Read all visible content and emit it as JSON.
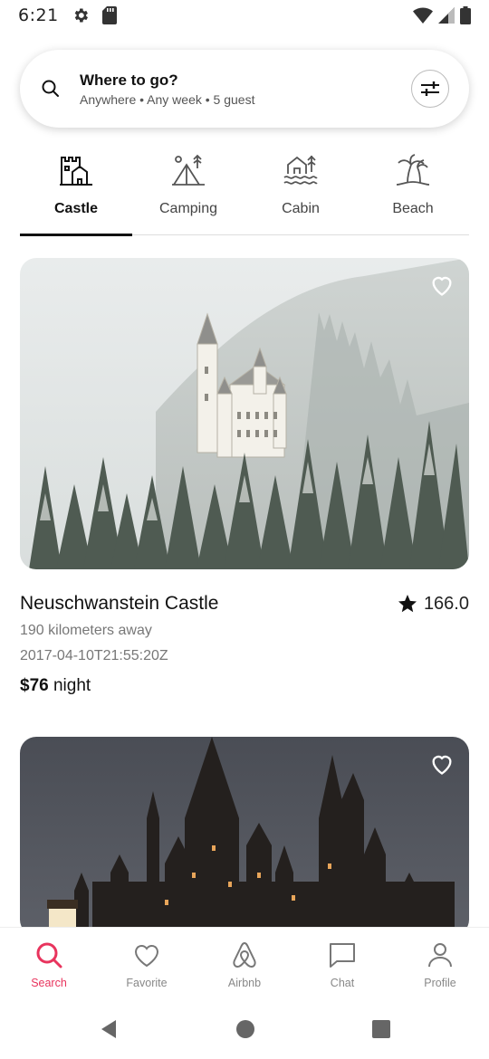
{
  "status_bar": {
    "time": "6:21",
    "icons": [
      "gear-icon",
      "sd-card-icon",
      "wifi-icon",
      "signal-icon",
      "battery-icon"
    ]
  },
  "search": {
    "title": "Where to go?",
    "subtitle": "Anywhere • Any week • 5 guest",
    "icon": "search-icon",
    "filter_icon": "sliders-icon"
  },
  "categories": [
    {
      "label": "Castle",
      "icon": "castle-icon",
      "active": true
    },
    {
      "label": "Camping",
      "icon": "camping-icon",
      "active": false
    },
    {
      "label": "Cabin",
      "icon": "cabin-icon",
      "active": false
    },
    {
      "label": "Beach",
      "icon": "beach-icon",
      "active": false
    }
  ],
  "listings": [
    {
      "title": "Neuschwanstein Castle",
      "rating": "166.0",
      "distance": "190 kilometers away",
      "date": "2017-04-10T21:55:20Z",
      "price": "$76",
      "price_unit": "night",
      "image": "snowy-castle-photo"
    },
    {
      "image": "dark-castle-photo"
    }
  ],
  "bottom_nav": [
    {
      "label": "Search",
      "icon": "search-icon",
      "active": true
    },
    {
      "label": "Favorite",
      "icon": "heart-icon",
      "active": false
    },
    {
      "label": "Airbnb",
      "icon": "airbnb-icon",
      "active": false
    },
    {
      "label": "Chat",
      "icon": "chat-icon",
      "active": false
    },
    {
      "label": "Profile",
      "icon": "profile-icon",
      "active": false
    }
  ],
  "colors": {
    "accent": "#e8345d",
    "text": "#222222",
    "muted": "#777777"
  }
}
